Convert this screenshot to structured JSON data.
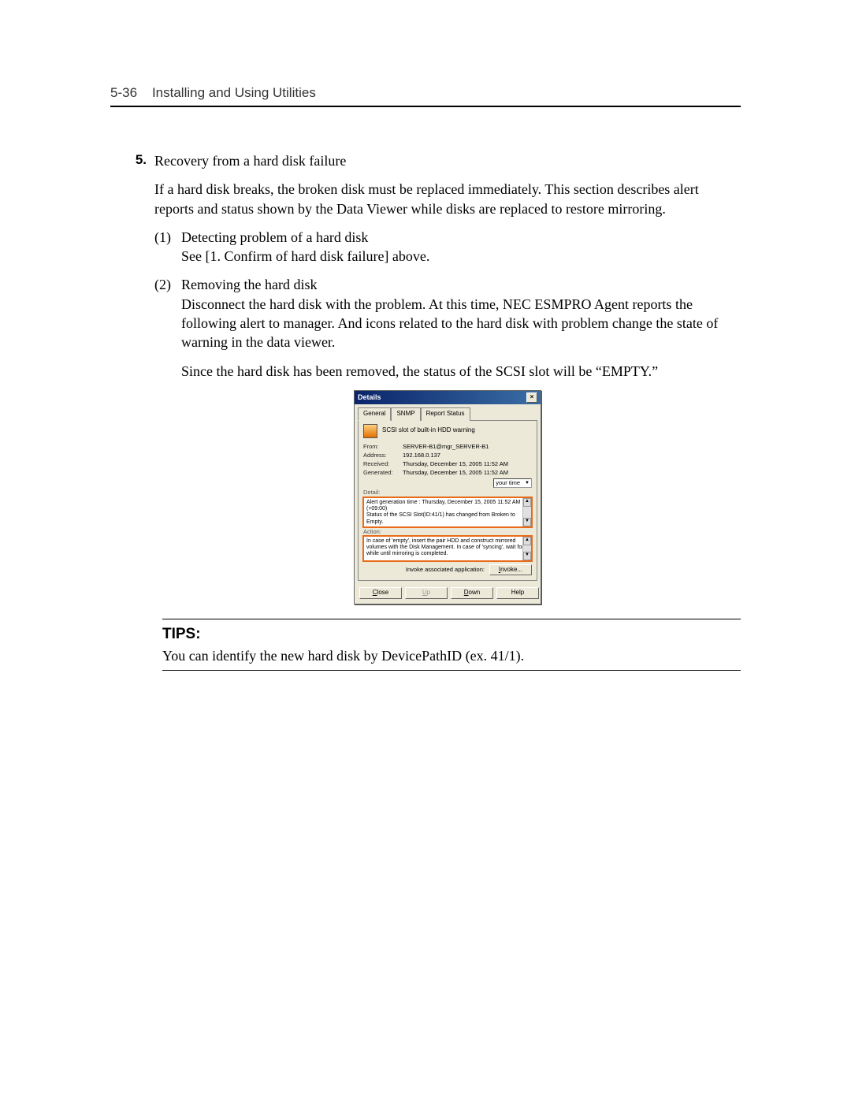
{
  "header": {
    "page_number": "5-36",
    "section_title": "Installing and Using Utilities"
  },
  "step": {
    "number": "5.",
    "title": "Recovery from a hard disk failure",
    "intro": "If a hard disk breaks, the broken disk must be replaced immediately. This section describes alert reports and status shown by the Data Viewer while disks are replaced to restore mirroring.",
    "sub1_num": "(1)",
    "sub1_title": "Detecting problem of a hard disk",
    "sub1_body": "See [1. Confirm of hard disk failure] above.",
    "sub2_num": "(2)",
    "sub2_title": "Removing the hard disk",
    "sub2_p1": "Disconnect the hard disk with the problem. At this time, NEC ESMPRO Agent reports the following alert to manager. And icons related to the hard disk with problem change the state of warning in the data viewer.",
    "sub2_p2": "Since the hard disk has been removed, the status of the SCSI slot will be “EMPTY.”"
  },
  "dialog": {
    "title": "Details",
    "tabs": {
      "general": "General",
      "snmp": "SNMP",
      "report": "Report Status"
    },
    "summary": "SCSI slot of built-in HDD warning",
    "fields": {
      "from_label": "From:",
      "from_value": "SERVER-B1@mgr_SERVER-B1",
      "address_label": "Address:",
      "address_value": "192.168.0.137",
      "received_label": "Received:",
      "received_value": "Thursday, December 15, 2005 11:52 AM",
      "generated_label": "Generated:",
      "generated_value": "Thursday, December 15, 2005 11:52 AM"
    },
    "time_selector": "your time",
    "detail_label": "Detail:",
    "detail_text": "Alert generation time : Thursday, December 15, 2005 11:52 AM (+09:00)\nStatus of the SCSI Slot(ID:41/1) has changed from Broken to Empty.",
    "action_label": "Action:",
    "action_text": "In case of 'empty', insert the pair HDD and construct mirrored volumes with the Disk Management. In case of 'syncing', wait for a while until mirroring is completed.",
    "invoke_label": "Invoke associated application:",
    "invoke_button": "Invoke...",
    "buttons": {
      "close": "Close",
      "up": "Up",
      "down": "Down",
      "help": "Help"
    }
  },
  "tips": {
    "heading": "TIPS:",
    "body": "You can identify the new hard disk by DevicePathID (ex. 41/1)."
  }
}
